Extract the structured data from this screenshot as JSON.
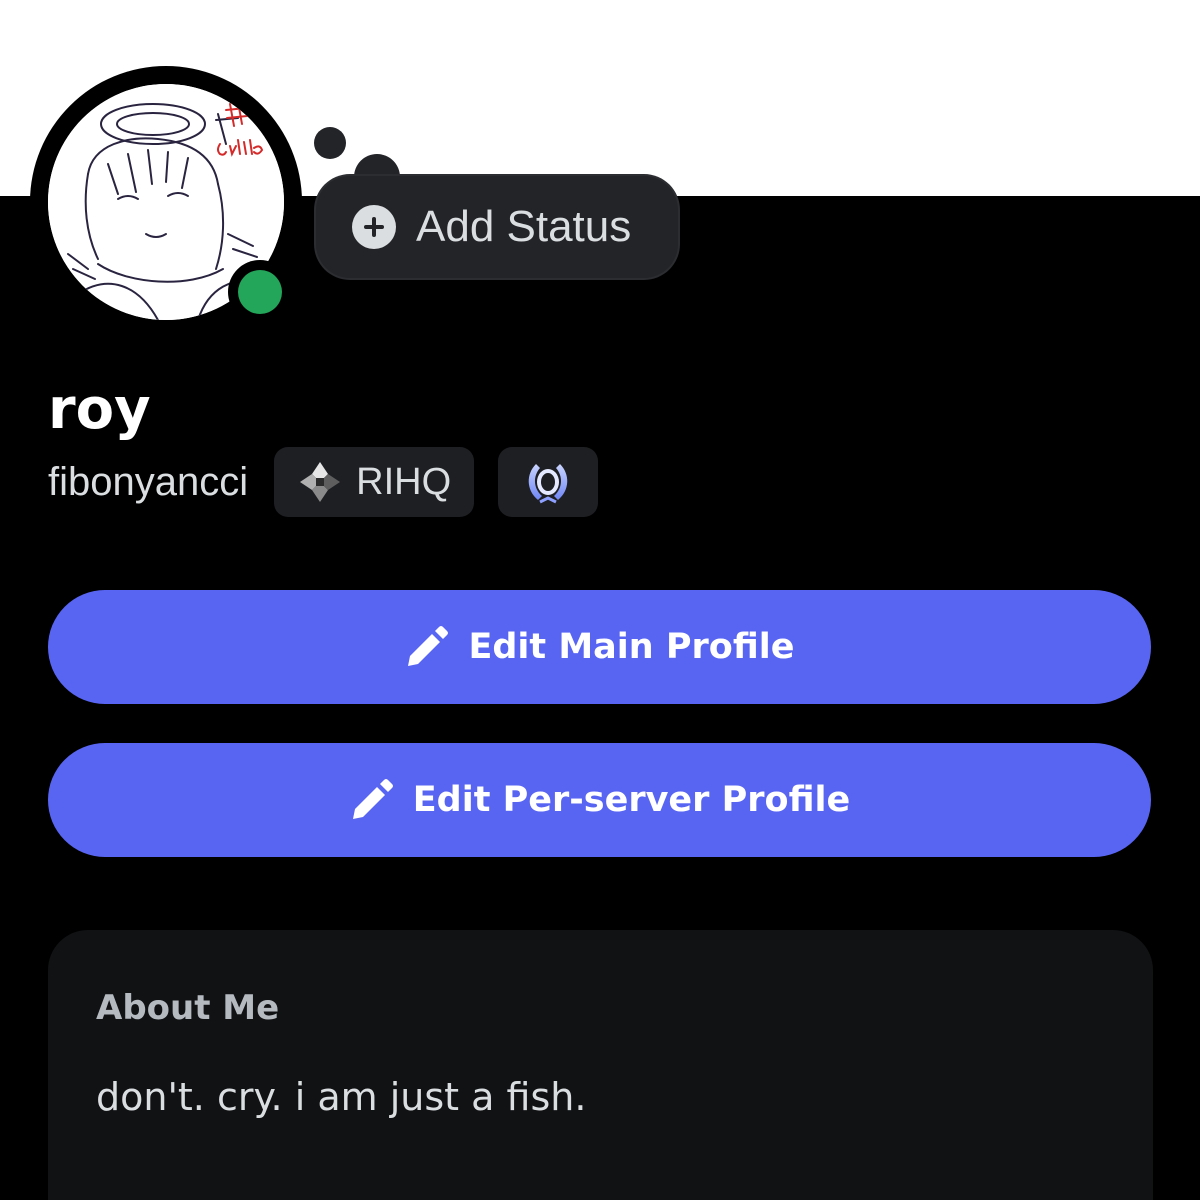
{
  "profile": {
    "display_name": "roy",
    "username": "fibonyancci",
    "online_status": "online"
  },
  "status_bubble": {
    "label": "Add Status",
    "icon": "plus-circle-icon"
  },
  "badges": [
    {
      "label": "RIHQ",
      "icon": "server-tag-icon"
    },
    {
      "label": "",
      "icon": "laurel-badge-icon"
    }
  ],
  "buttons": {
    "edit_main": {
      "label": "Edit Main Profile",
      "icon": "pencil-icon"
    },
    "edit_per_server": {
      "label": "Edit Per-server Profile",
      "icon": "pencil-icon"
    }
  },
  "about": {
    "title": "About Me",
    "text": "don't. cry. i am just a fish."
  },
  "colors": {
    "accent": "#5865f2",
    "online": "#23a55a",
    "background": "#000000",
    "card": "#111214",
    "banner": "#ffffff"
  }
}
